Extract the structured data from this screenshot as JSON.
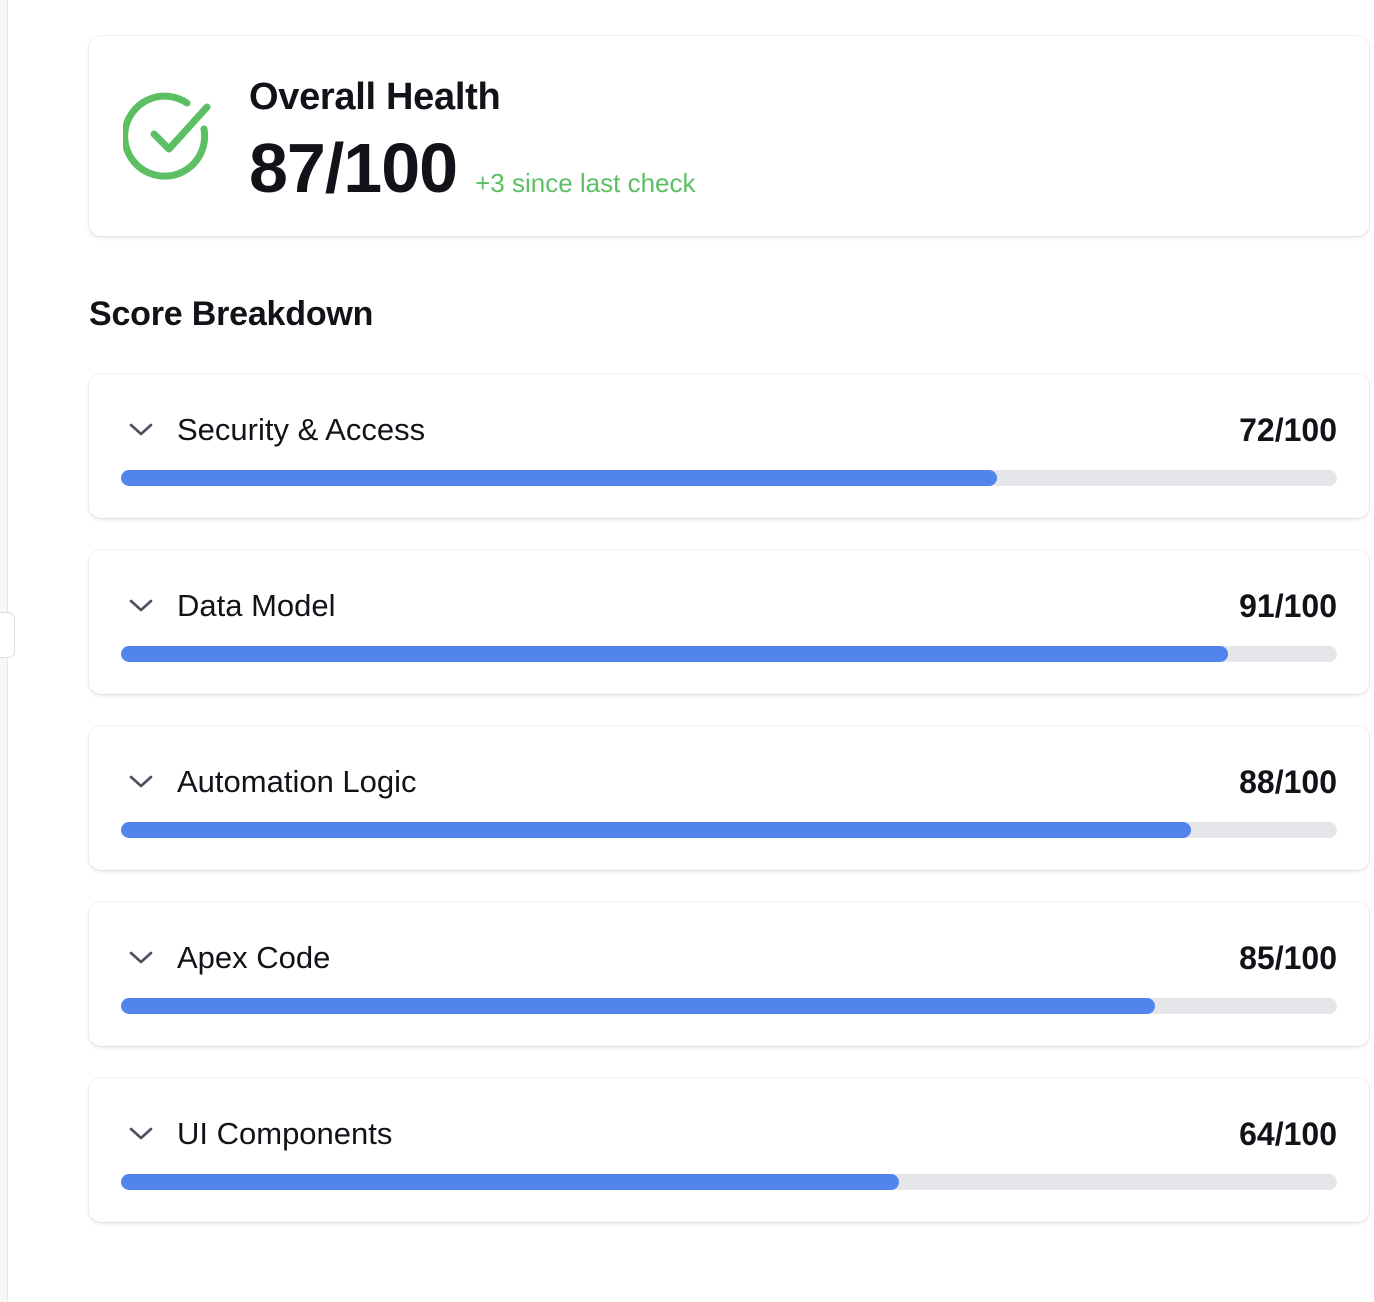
{
  "overall": {
    "title": "Overall Health",
    "score": "87/100",
    "score_value": 87,
    "delta": "+3 since last check",
    "icon": "check-circle-icon",
    "accent_color": "#5cbf63"
  },
  "breakdown": {
    "title": "Score Breakdown",
    "bar_color": "#5184ec",
    "track_color": "#e5e6ea",
    "categories": [
      {
        "name": "Security & Access",
        "score": "72/100",
        "value": 72,
        "icon": "chevron-down-icon"
      },
      {
        "name": "Data Model",
        "score": "91/100",
        "value": 91,
        "icon": "chevron-down-icon"
      },
      {
        "name": "Automation Logic",
        "score": "88/100",
        "value": 88,
        "icon": "chevron-down-icon"
      },
      {
        "name": "Apex Code",
        "score": "85/100",
        "value": 85,
        "icon": "chevron-down-icon"
      },
      {
        "name": "UI Components",
        "score": "64/100",
        "value": 64,
        "icon": "chevron-down-icon"
      }
    ]
  }
}
